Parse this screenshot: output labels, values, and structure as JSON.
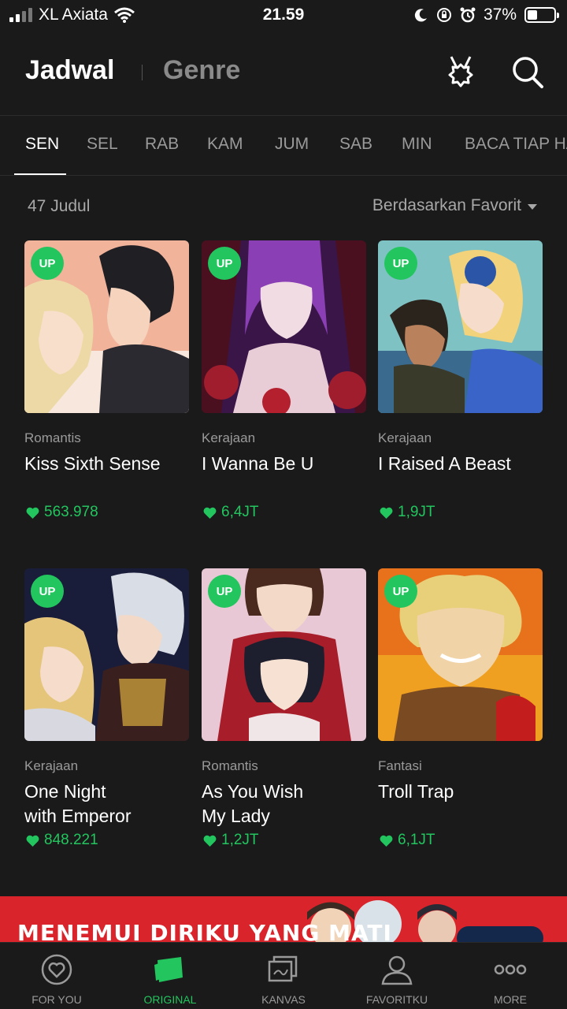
{
  "status": {
    "carrier": "XL Axiata",
    "time": "21.59",
    "battery": "37%",
    "battery_level": 0.37
  },
  "header": {
    "title": "Jadwal",
    "secondary": "Genre"
  },
  "tabs": [
    "SEN",
    "SEL",
    "RAB",
    "KAM",
    "JUM",
    "SAB",
    "MIN",
    "BACA TIAP HARI"
  ],
  "list": {
    "count": "47 Judul",
    "sort": "Berdasarkan Favorit"
  },
  "badge": "UP",
  "cards": [
    {
      "genre": "Romantis",
      "title": "Kiss Sixth Sense",
      "likes": "563.978"
    },
    {
      "genre": "Kerajaan",
      "title": "I Wanna Be U",
      "likes": "6,4JT"
    },
    {
      "genre": "Kerajaan",
      "title": "I Raised A Beast",
      "likes": "1,9JT"
    },
    {
      "genre": "Kerajaan",
      "title": "One Night\nwith Emperor",
      "likes": "848.221"
    },
    {
      "genre": "Romantis",
      "title": "As You Wish\nMy Lady",
      "likes": "1,2JT"
    },
    {
      "genre": "Fantasi",
      "title": "Troll Trap",
      "likes": "6,1JT"
    }
  ],
  "banner": {
    "text": "MENEMUI DIRIKU YANG MATI"
  },
  "nav": [
    {
      "label": "FOR YOU",
      "icon": "heart-circle-icon"
    },
    {
      "label": "ORIGINAL",
      "icon": "original-book-icon"
    },
    {
      "label": "KANVAS",
      "icon": "canvas-icon"
    },
    {
      "label": "FAVORITKU",
      "icon": "profile-icon"
    },
    {
      "label": "MORE",
      "icon": "more-dots-icon"
    }
  ],
  "colors": {
    "accent": "#22c55e",
    "background": "#1a1a1a",
    "banner": "#d8242a"
  }
}
